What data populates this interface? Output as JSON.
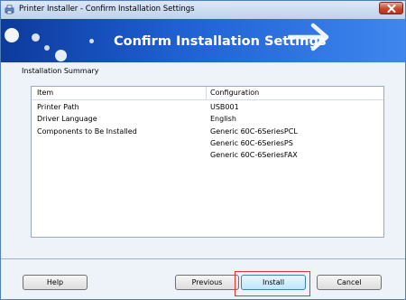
{
  "window": {
    "title": "Printer Installer - Confirm Installation Settings",
    "icon": "printer-installer-icon"
  },
  "banner": {
    "title": "Confirm Installation Settings"
  },
  "summary": {
    "label": "Installation Summary",
    "columns": [
      "Item",
      "Configuration"
    ],
    "rows": [
      {
        "item": "Printer Path",
        "values": [
          "USB001"
        ]
      },
      {
        "item": "Driver Language",
        "values": [
          "English"
        ]
      },
      {
        "item": "Components to Be Installed",
        "values": [
          "Generic 60C-6SeriesPCL",
          "Generic 60C-6SeriesPS",
          "Generic 60C-6SeriesFAX"
        ]
      }
    ]
  },
  "buttons": {
    "help": "Help",
    "previous": "Previous",
    "install": "Install",
    "cancel": "Cancel"
  },
  "colors": {
    "banner_dark": "#0d3a9c",
    "banner_light": "#3f86ee",
    "highlight": "#e23232"
  }
}
